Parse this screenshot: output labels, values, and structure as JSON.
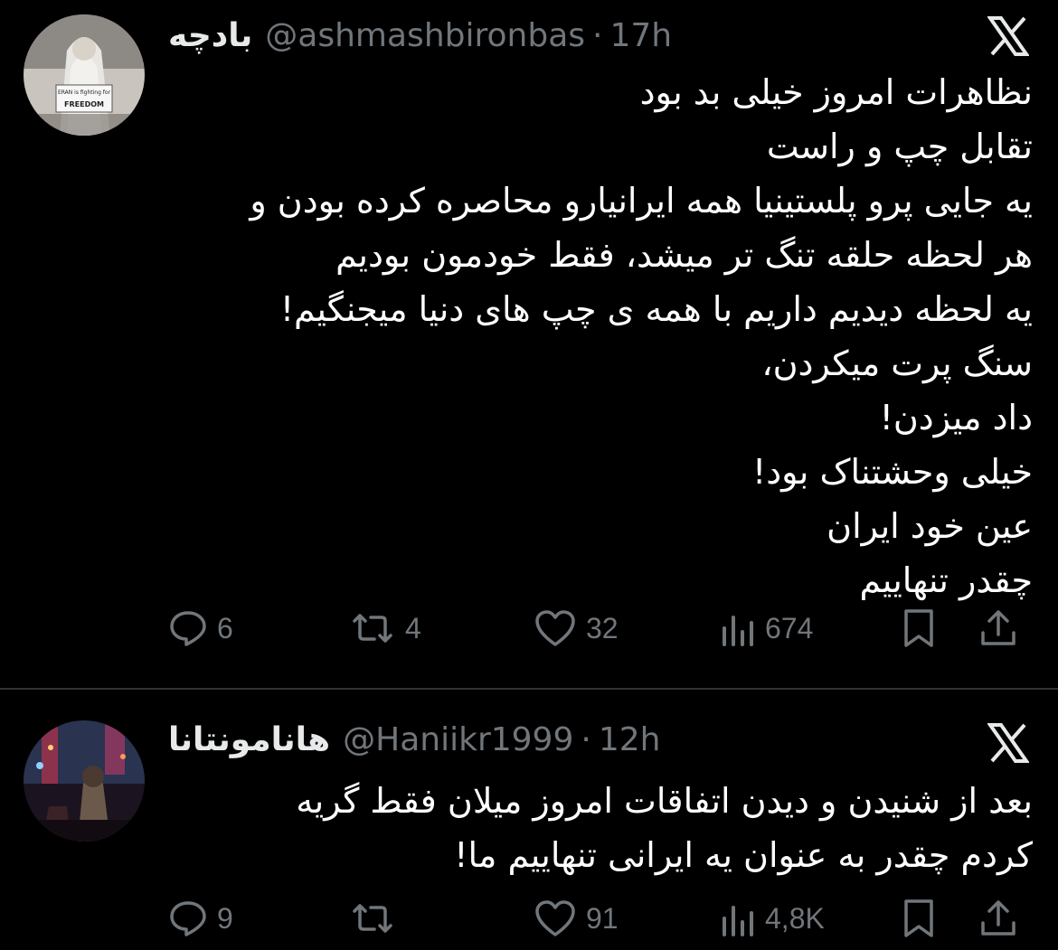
{
  "tweets": [
    {
      "display_name": "بادچه",
      "handle": "@ashmashbironbas",
      "time": "17h",
      "avatar_sign": [
        "ERAN is fighting for",
        "FREEDOM"
      ],
      "lines": [
        "نظاهرات امروز خیلی بد بود",
        "تقابل چپ و راست",
        "یه جایی پرو پلستینیا همه ایرانیارو محاصره کرده بودن و",
        "هر لحظه حلقه تنگ تر میشد، فقط خودمون بودیم",
        "یه لحظه دیدیم داریم با همه ی چپ های دنیا میجنگیم!",
        "سنگ پرت میکردن،",
        "داد میزدن!",
        "خیلی وحشتناک بود!",
        "عین خود ایران",
        "چقدر تنهاییم"
      ],
      "replies": "6",
      "reposts": "4",
      "likes": "32",
      "views": "674"
    },
    {
      "display_name": "هانامونتانا",
      "handle": "@Haniikr1999",
      "time": "12h",
      "lines": [
        "بعد از شنیدن و دیدن اتفاقات امروز میلان فقط گریه",
        "کردم چقدر به عنوان یه ایرانی تنهاییم ما!"
      ],
      "replies": "9",
      "reposts": "",
      "likes": "91",
      "views": "4,8K"
    }
  ],
  "separator": "·",
  "icons": [
    "x-logo-icon",
    "reply-icon",
    "repost-icon",
    "like-icon",
    "views-icon",
    "bookmark-icon",
    "share-icon"
  ],
  "colors": {
    "background": "#000000",
    "text": "#e7e9ea",
    "secondary": "#71767b",
    "divider": "#2f3336"
  }
}
